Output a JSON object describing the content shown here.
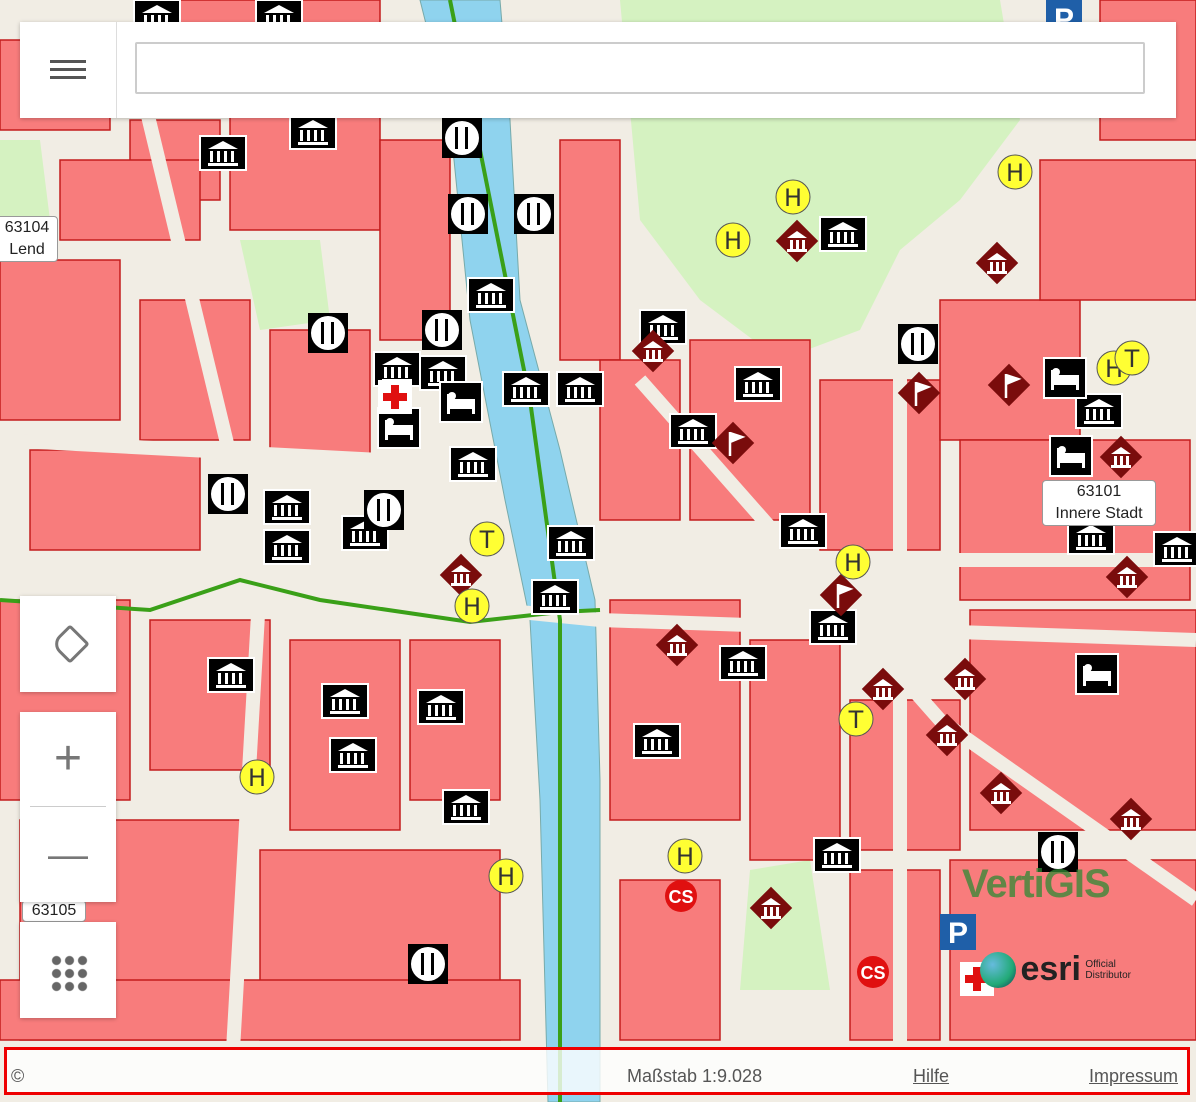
{
  "header": {
    "search_value": "",
    "search_placeholder": ""
  },
  "map": {
    "districts": [
      {
        "code": "63104",
        "name": "Lend"
      },
      {
        "code": "63101",
        "name": "Innere Stadt"
      },
      {
        "code": "63105",
        "name": ""
      }
    ],
    "poi_icons": [
      "museum-icon",
      "restaurant-icon",
      "hotel-icon",
      "bus-stop-h-icon",
      "tram-stop-t-icon",
      "parking-icon",
      "first-aid-icon",
      "carsharing-icon",
      "flag-icon"
    ]
  },
  "controls": {
    "menu_icon": "hamburger-icon",
    "tag_icon": "tag-icon",
    "zoom_in": "+",
    "zoom_out": "—",
    "apps_icon": "grid-dots-icon"
  },
  "footer": {
    "copyright": "©",
    "scale": "Maßstab 1:9.028",
    "help": "Hilfe",
    "imprint": "Impressum"
  },
  "brands": {
    "vertigis": "VertiGIS",
    "esri": "esri",
    "esri_sub1": "Official",
    "esri_sub2": "Distributor"
  },
  "colors": {
    "building": "#f87c7c",
    "river": "#8fd3ee",
    "park": "#d5f2c1",
    "route": "#3aa018"
  }
}
